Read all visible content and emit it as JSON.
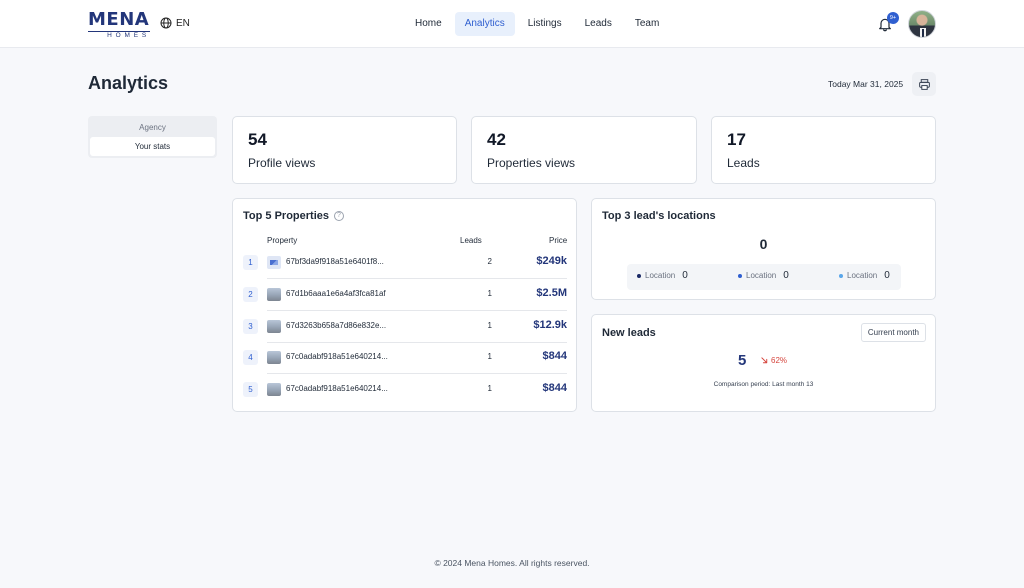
{
  "brand": {
    "name": "MENA",
    "subtitle": "HOMES"
  },
  "language": {
    "label": "EN"
  },
  "nav": {
    "items": [
      {
        "label": "Home",
        "active": false
      },
      {
        "label": "Analytics",
        "active": true
      },
      {
        "label": "Listings",
        "active": false
      },
      {
        "label": "Leads",
        "active": false
      },
      {
        "label": "Team",
        "active": false
      }
    ]
  },
  "notifications": {
    "badge": "9+"
  },
  "page": {
    "title": "Analytics",
    "today": "Today Mar 31, 2025"
  },
  "scope_toggle": {
    "options": [
      {
        "label": "Agency",
        "active": false
      },
      {
        "label": "Your stats",
        "active": true
      }
    ]
  },
  "stats": [
    {
      "value": "54",
      "label": "Profile views"
    },
    {
      "value": "42",
      "label": "Properties views"
    },
    {
      "value": "17",
      "label": "Leads"
    }
  ],
  "top_properties": {
    "title": "Top 5 Properties",
    "columns": {
      "property": "Property",
      "leads": "Leads",
      "price": "Price"
    },
    "rows": [
      {
        "rank": "1",
        "id": "67bf3da9f918a51e6401f8...",
        "leads": "2",
        "price": "$249k",
        "thumb": "placeholder"
      },
      {
        "rank": "2",
        "id": "67d1b6aaa1e6a4af3fca81af",
        "leads": "1",
        "price": "$2.5M",
        "thumb": "photo"
      },
      {
        "rank": "3",
        "id": "67d3263b658a7d86e832e...",
        "leads": "1",
        "price": "$12.9k",
        "thumb": "photo"
      },
      {
        "rank": "4",
        "id": "67c0adabf918a51e640214...",
        "leads": "1",
        "price": "$844",
        "thumb": "photo"
      },
      {
        "rank": "5",
        "id": "67c0adabf918a51e640214...",
        "leads": "1",
        "price": "$844",
        "thumb": "photo"
      }
    ]
  },
  "lead_locations": {
    "title": "Top 3 lead's locations",
    "total": "0",
    "items": [
      {
        "label": "Location",
        "value": "0",
        "color": "#1b2a66"
      },
      {
        "label": "Location",
        "value": "0",
        "color": "#2f5fd0"
      },
      {
        "label": "Location",
        "value": "0",
        "color": "#5aa6ea"
      }
    ]
  },
  "new_leads": {
    "title": "New leads",
    "period_button": "Current month",
    "value": "5",
    "trend": "62%",
    "trend_icon": "arrow-down-right-icon",
    "comparison": "Comparison period: Last month 13"
  },
  "footer": {
    "text": "© 2024 Mena Homes. All rights reserved."
  }
}
